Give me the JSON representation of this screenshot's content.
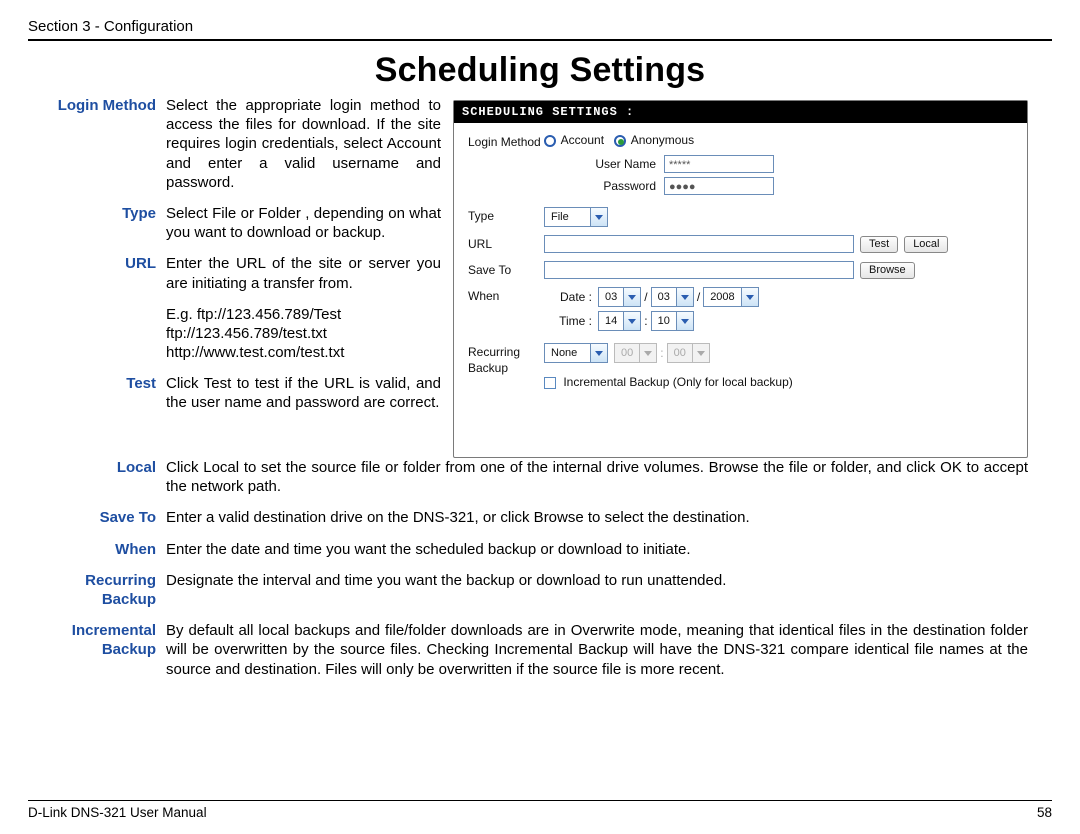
{
  "header": "Section 3 - Configuration",
  "title": "Scheduling Settings",
  "defs": {
    "login_method": {
      "term": "Login Method",
      "body": "Select the appropriate login method to access the files for download. If the site requires login credentials, select Account and enter a valid username and password."
    },
    "type": {
      "term": "Type",
      "body": "Select File or Folder , depending on what you want to download or backup."
    },
    "url": {
      "term": "URL",
      "body": "Enter the URL of the site or server you are initiating a transfer from."
    },
    "url_eg": {
      "body": "E.g.  ftp://123.456.789/Test\n         ftp://123.456.789/test.txt\n         http://www.test.com/test.txt"
    },
    "test": {
      "term": "Test",
      "body": "Click Test to test if the URL is valid, and the user name and password are correct."
    },
    "local": {
      "term": "Local",
      "body": "Click Local  to set the source file or folder from one of the internal drive volumes. Browse the file or folder, and click OK to accept the network path."
    },
    "save_to": {
      "term": "Save To",
      "body": "Enter a valid destination drive on the DNS-321, or click Browse  to select the destination."
    },
    "when": {
      "term": "When",
      "body": "Enter the date and time you want the scheduled backup or download to initiate."
    },
    "recurring": {
      "term": "Recurring Backup",
      "body": "Designate the interval and time you want the backup or download to run unattended."
    },
    "incremental": {
      "term": "Incremental Backup",
      "body": "By default all local backups and file/folder downloads are in Overwrite mode, meaning that identical files in the destination folder will be overwritten by the source files. Checking Incremental Backup   will have the DNS-321 compare identical file names at the source and destination. Files will only be overwritten if the source file is more recent."
    }
  },
  "ss": {
    "title": "SCHEDULING SETTINGS :",
    "login_method_label": "Login Method",
    "account_label": "Account",
    "anonymous_label": "Anonymous",
    "username_label": "User Name",
    "username_value": "*****",
    "password_label": "Password",
    "password_value": "●●●●",
    "type_label": "Type",
    "type_value": "File",
    "url_label": "URL",
    "test_btn": "Test",
    "local_btn": "Local",
    "save_to_label": "Save To",
    "browse_btn": "Browse",
    "when_label": "When",
    "date_label": "Date :",
    "date_mm": "03",
    "date_dd": "03",
    "date_yy": "2008",
    "time_label": "Time :",
    "time_hh": "14",
    "time_mm": "10",
    "recurring_label": "Recurring Backup",
    "recurring_value": "None",
    "recurring_hh": "00",
    "recurring_mm": "00",
    "incremental_label": "Incremental Backup (Only for local backup)"
  },
  "footer": {
    "left": "D-Link DNS-321 User Manual",
    "page": "58"
  }
}
